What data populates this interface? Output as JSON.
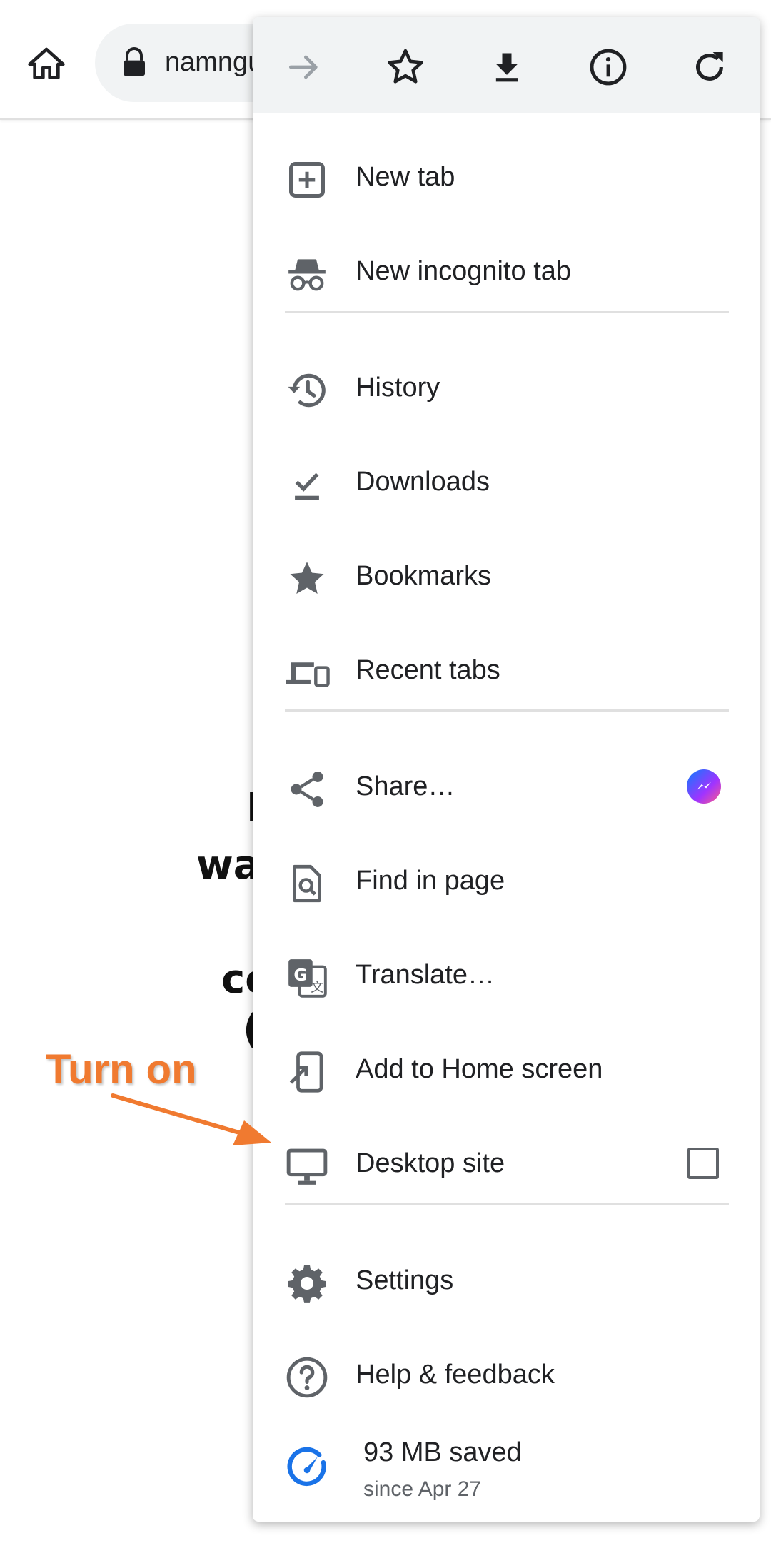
{
  "browser": {
    "url_text": "namngu",
    "icons": [
      "home-icon",
      "lock-icon"
    ]
  },
  "background_text": {
    "line1": "I",
    "line2": "wa",
    "line3": "co",
    "line4": "("
  },
  "menu": {
    "toolbar": [
      "forward-icon",
      "bookmark-star-icon",
      "download-icon",
      "info-icon",
      "refresh-icon"
    ],
    "items": [
      {
        "label": "New tab",
        "icon": "new-tab-icon"
      },
      {
        "label": "New incognito tab",
        "icon": "incognito-icon"
      },
      {
        "label": "History",
        "icon": "history-icon"
      },
      {
        "label": "Downloads",
        "icon": "downloads-icon"
      },
      {
        "label": "Bookmarks",
        "icon": "bookmarks-star-icon"
      },
      {
        "label": "Recent tabs",
        "icon": "recent-tabs-icon"
      },
      {
        "label": "Share…",
        "icon": "share-icon"
      },
      {
        "label": "Find in page",
        "icon": "find-in-page-icon"
      },
      {
        "label": "Translate…",
        "icon": "translate-icon"
      },
      {
        "label": "Add to Home screen",
        "icon": "add-to-home-icon"
      },
      {
        "label": "Desktop site",
        "icon": "desktop-icon",
        "checked": false
      },
      {
        "label": "Settings",
        "icon": "gear-icon"
      },
      {
        "label": "Help & feedback",
        "icon": "help-icon"
      }
    ],
    "data_saver": {
      "title": "93 MB saved",
      "subtitle": "since Apr 27",
      "icon": "data-saver-gauge-icon"
    }
  },
  "annotation": {
    "text": "Turn on",
    "color": "#f07a30"
  },
  "colors": {
    "icon": "#5f6368",
    "text": "#202124",
    "menu_header_bg": "#f1f3f4",
    "accent_blue": "#1a73e8"
  }
}
